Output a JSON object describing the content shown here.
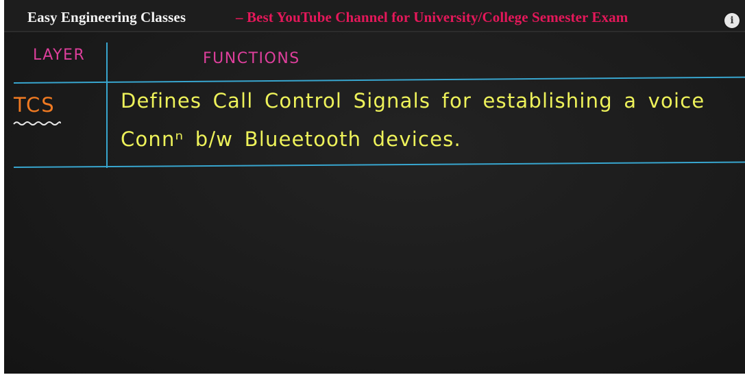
{
  "banner": {
    "brand": "Easy Engineering Classes",
    "tagline": "– Best YouTube Channel for University/College Semester Exam",
    "info_label": "i"
  },
  "table": {
    "headers": {
      "layer": "LAYER",
      "functions": "FUNCTIONS"
    },
    "rows": [
      {
        "layer": "TCS",
        "function_lines": [
          "Defines Call Control Signals for establishing a voice",
          "Connⁿ b/w Blueetooth devices."
        ]
      }
    ]
  },
  "colors": {
    "board": "#1b1b1b",
    "brand_text": "#f3f3f3",
    "tagline_text": "#e4185a",
    "rule_lines": "#38a6cf",
    "header_chalk": "#de3f9c",
    "layer_chalk": "#f07a22",
    "function_chalk": "#eef25a",
    "underline_chalk": "#e8e8e8"
  },
  "icons": {
    "info": "info-icon"
  }
}
